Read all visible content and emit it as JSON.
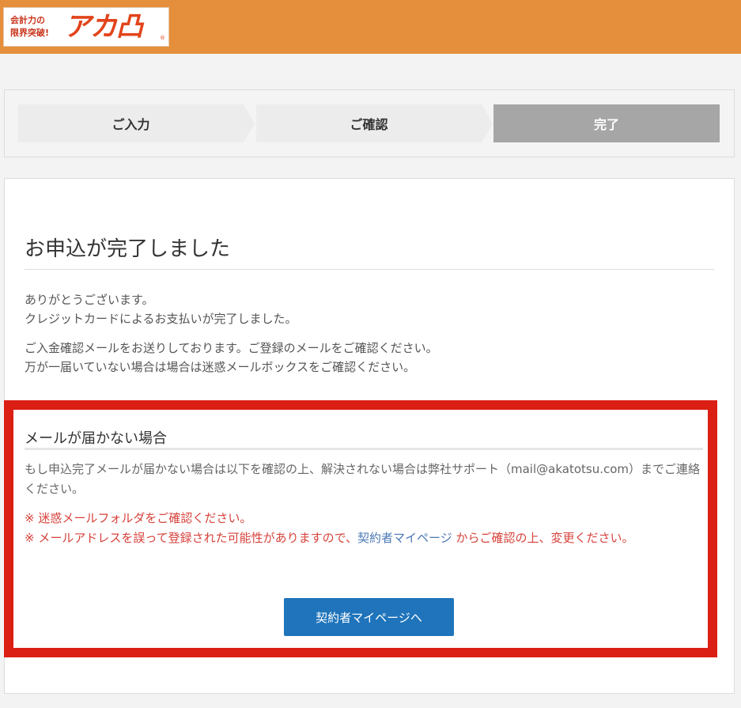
{
  "header": {
    "logo_tagline": "会計力の\n限界突破!",
    "logo_brand": "アカ凸",
    "logo_reg": "®",
    "brand_color": "#e58f3c"
  },
  "steps": [
    {
      "label": "ご入力",
      "active": false
    },
    {
      "label": "ご確認",
      "active": false
    },
    {
      "label": "完了",
      "active": true
    }
  ],
  "main": {
    "title": "お申込が完了しました",
    "para1": [
      "ありがとうございます。",
      "クレジットカードによるお支払いが完了しました。"
    ],
    "para2": [
      "ご入金確認メールをお送りしております。ご登録のメールをご確認ください。",
      "万が一届いていない場合は場合は迷惑メールボックスをご確認ください。"
    ]
  },
  "notice": {
    "title": "メールが届かない場合",
    "text": "もし申込完了メールが届かない場合は以下を確認の上、解決されない場合は弊社サポート（mail@akatotsu.com）までご連絡ください。",
    "note1": "※ 迷惑メールフォルダをご確認ください。",
    "note2_before": "※ メールアドレスを誤って登録された可能性がありますので、",
    "note2_link": "契約者マイページ",
    "note2_after": " からご確認の上、変更ください。",
    "button_label": "契約者マイページへ",
    "frame_color": "#db1f14",
    "button_color": "#1f74bb"
  }
}
